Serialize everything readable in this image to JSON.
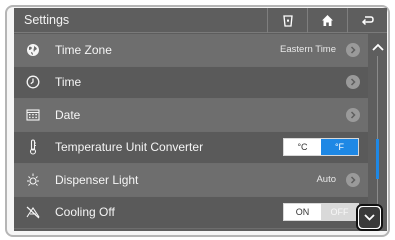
{
  "header": {
    "title": "Settings"
  },
  "rows": [
    {
      "label": "Time Zone",
      "value": "Eastern Time",
      "icon": "globe-icon"
    },
    {
      "label": "Time",
      "icon": "clock-icon"
    },
    {
      "label": "Date",
      "icon": "calendar-icon"
    },
    {
      "label": "Temperature Unit Converter",
      "icon": "thermometer-icon",
      "options": [
        "°C",
        "°F"
      ],
      "selected": "°F"
    },
    {
      "label": "Dispenser Light",
      "value": "Auto",
      "icon": "light-icon"
    },
    {
      "label": "Cooling Off",
      "icon": "cooling-off-icon",
      "options": [
        "ON",
        "OFF"
      ],
      "selected": "ON"
    }
  ],
  "colors": {
    "accent": "#1e88e5",
    "header_bg": "#5e5e5e",
    "row_alt": "#6e6e6e"
  }
}
